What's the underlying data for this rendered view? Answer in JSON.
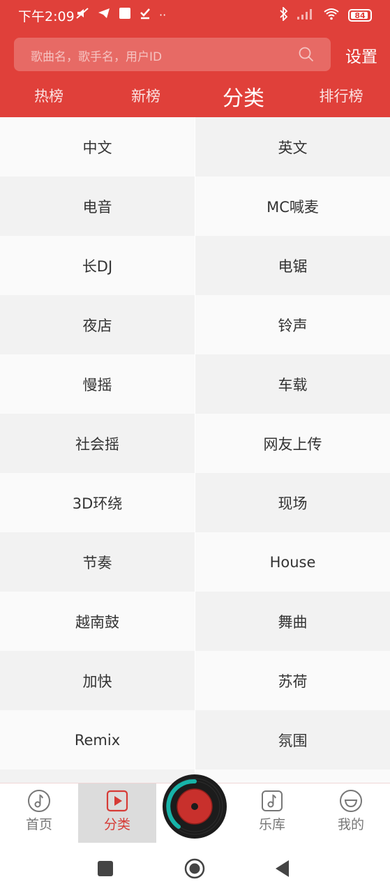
{
  "status_bar": {
    "time": "下午2:09",
    "battery": "84"
  },
  "search": {
    "placeholder": "歌曲名，歌手名，用户ID"
  },
  "header": {
    "settings_label": "设置"
  },
  "tabs": [
    {
      "label": "热榜",
      "active": false
    },
    {
      "label": "新榜",
      "active": false
    },
    {
      "label": "分类",
      "active": true
    },
    {
      "label": "排行榜",
      "active": false
    }
  ],
  "categories": [
    [
      "中文",
      "英文"
    ],
    [
      "电音",
      "MC喊麦"
    ],
    [
      "长DJ",
      "电锯"
    ],
    [
      "夜店",
      "铃声"
    ],
    [
      "慢摇",
      "车载"
    ],
    [
      "社会摇",
      "网友上传"
    ],
    [
      "3D环绕",
      "现场"
    ],
    [
      "节奏",
      "House"
    ],
    [
      "越南鼓",
      "舞曲"
    ],
    [
      "加快",
      "苏荷"
    ],
    [
      "Remix",
      "氛围"
    ]
  ],
  "bottom_nav": [
    {
      "label": "首页",
      "icon": "music-note-circle-icon",
      "active": false
    },
    {
      "label": "分类",
      "icon": "play-square-icon",
      "active": true
    },
    {
      "label": "乐库",
      "icon": "music-note-square-icon",
      "active": false
    },
    {
      "label": "我的",
      "icon": "smile-circle-icon",
      "active": false
    }
  ],
  "colors": {
    "accent": "#e0403a",
    "active_nav": "#d63b36",
    "progress_ring": "#17b3a8"
  }
}
